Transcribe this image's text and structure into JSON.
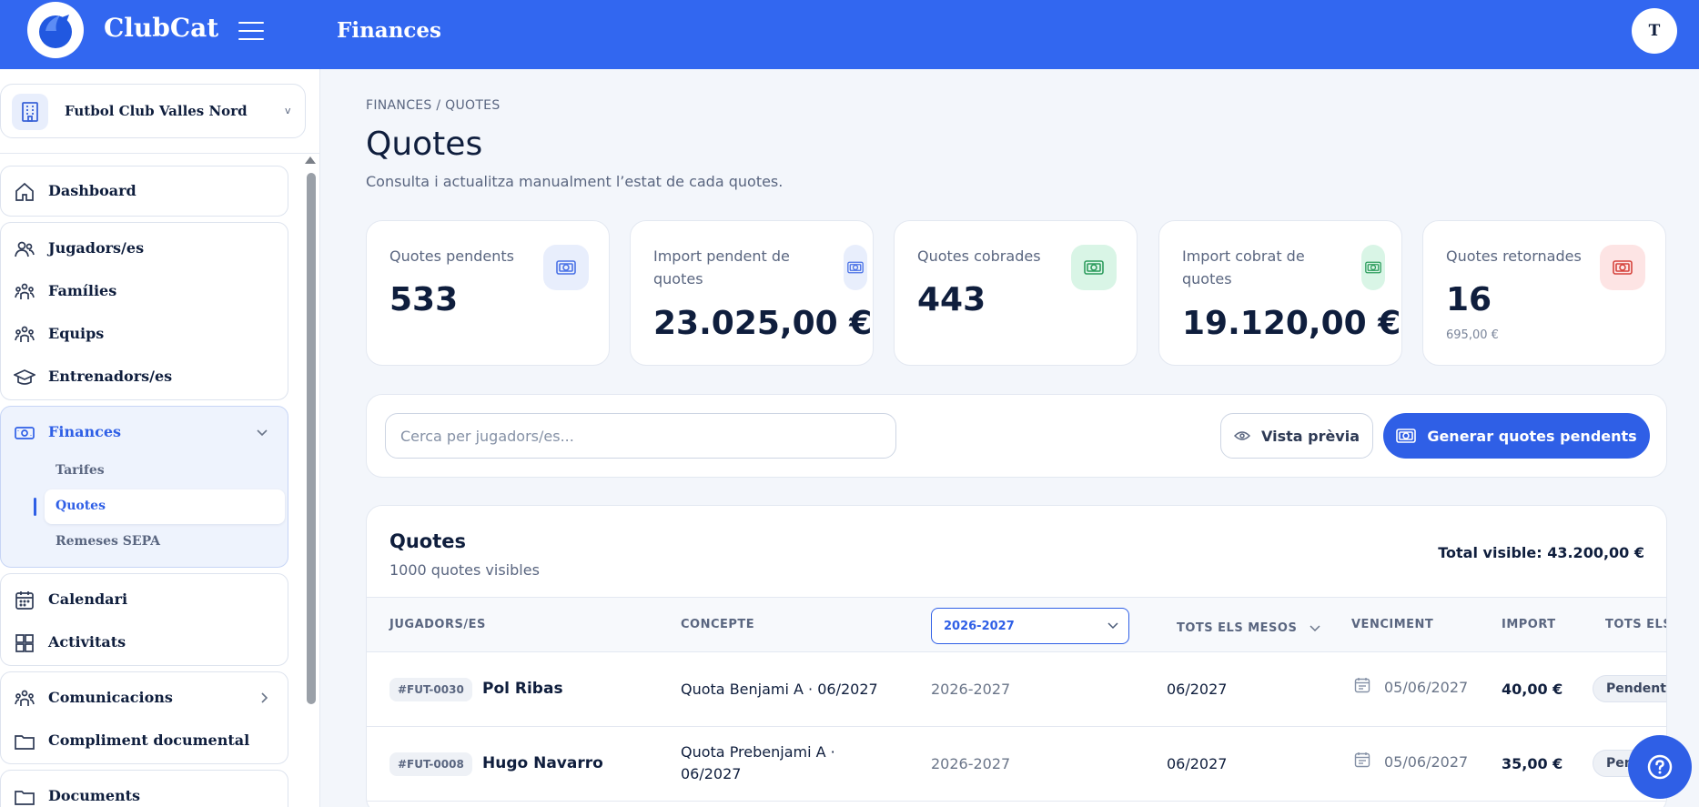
{
  "app": {
    "brand": "ClubCat",
    "section_title": "Finances",
    "user_initial": "T",
    "accent_color": "#3267f0"
  },
  "sidebar": {
    "club_name": "Futbol Club Valles Nord",
    "club_chevron": "v",
    "items": {
      "dashboard": "Dashboard",
      "players": "Jugadors/es",
      "families": "Famílies",
      "teams": "Equips",
      "coaches": "Entrenadors/es",
      "finances": "Finances",
      "rates": "Tarifes",
      "fees": "Quotes",
      "sepa": "Remeses SEPA",
      "calendar": "Calendari",
      "activities": "Activitats",
      "communications": "Comunicacions",
      "compliance": "Compliment documental",
      "documents": "Documents"
    },
    "icons": [
      "home-icon",
      "users-icon",
      "family-icon",
      "team-icon",
      "graduation-cap-icon",
      "money-icon",
      "calendar-icon",
      "puzzle-icon",
      "team-icon",
      "folder-icon",
      "folder-icon"
    ]
  },
  "page": {
    "breadcrumb": "FINANCES / QUOTES",
    "title": "Quotes",
    "subtitle": "Consulta i actualitza manualment l’estat de cada quotes."
  },
  "stats": [
    {
      "label": "Quotes pendents",
      "value": "533",
      "extra": "",
      "tone": "#e8eefc",
      "icon_color": "#4a72e6"
    },
    {
      "label": "Import pendent de quotes",
      "value": "23.025,00 €",
      "extra": "",
      "tone": "#e8eefc",
      "icon_color": "#4a72e6"
    },
    {
      "label": "Quotes cobrades",
      "value": "443",
      "extra": "",
      "tone": "#d9f5e6",
      "icon_color": "#2e9d5e"
    },
    {
      "label": "Import cobrat de quotes",
      "value": "19.120,00 €",
      "extra": "",
      "tone": "#d9f5e6",
      "icon_color": "#2e9d5e"
    },
    {
      "label": "Quotes retornades",
      "value": "16",
      "extra": "695,00 €",
      "tone": "#fde4e4",
      "icon_color": "#d6453e"
    }
  ],
  "search": {
    "placeholder": "Cerca per jugadors/es...",
    "preview_label": "Vista prèvia",
    "generate_label": "Generar quotes pendents"
  },
  "table": {
    "title": "Quotes",
    "subtitle": "1000 quotes visibles",
    "total": "Total visible: 43.200,00 €",
    "headers": {
      "player": "JUGADORS/ES",
      "concept": "CONCEPTE",
      "season_filter": "2026-2027",
      "months_filter": "TOTS ELS MESOS",
      "due": "VENCIMENT",
      "amount": "IMPORT",
      "status_filter": "TOTS ELS E"
    },
    "rows": [
      {
        "code": "#FUT-0030",
        "name": "Pol Ribas",
        "concept": "Quota Benjami A · 06/2027",
        "season": "2026-2027",
        "month": "06/2027",
        "due": "05/06/2027",
        "amount": "40,00 €",
        "status": "Pendent"
      },
      {
        "code": "#FUT-0008",
        "name": "Hugo Navarro",
        "concept": "Quota Prebenjami A · 06/2027",
        "season": "2026-2027",
        "month": "06/2027",
        "due": "05/06/2027",
        "amount": "35,00 €",
        "status": "Pen"
      }
    ]
  }
}
